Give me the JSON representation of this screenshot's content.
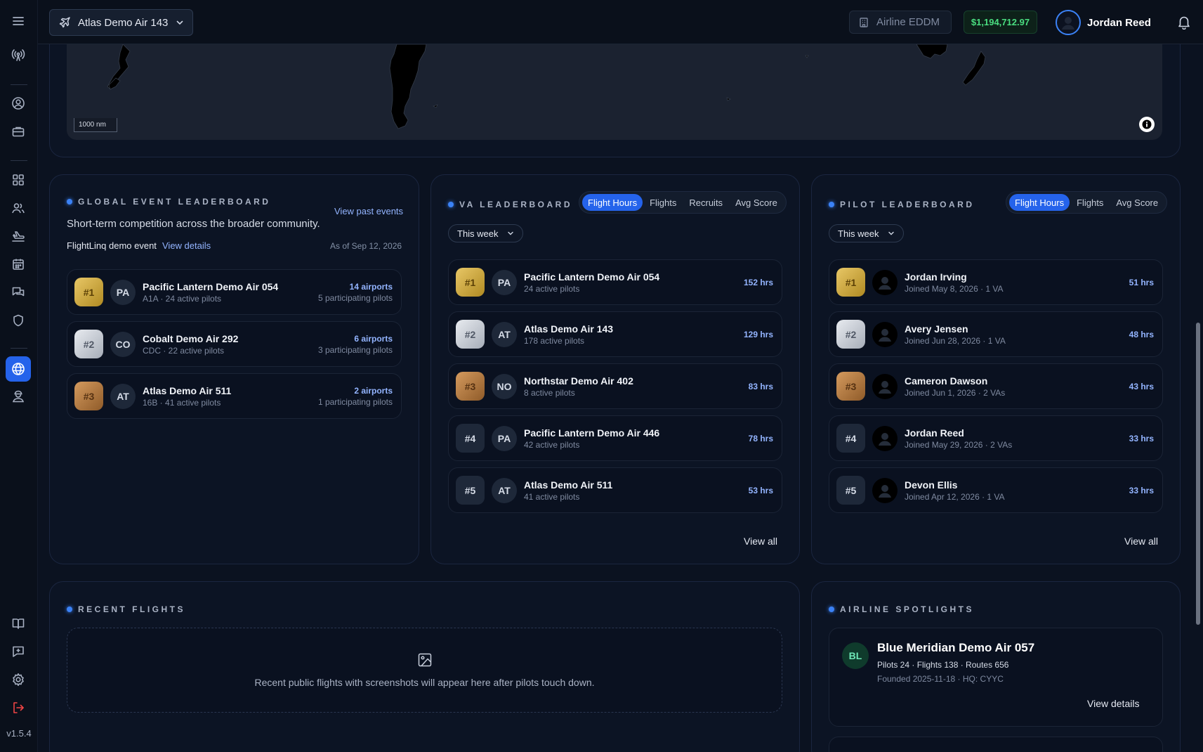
{
  "app": {
    "version": "v1.5.4"
  },
  "topbar": {
    "va_name": "Atlas Demo Air 143",
    "airline_label": "Airline EDDM",
    "balance": "$1,194,712.97",
    "user_name": "Jordan Reed"
  },
  "map": {
    "scale_label": "1000 nm"
  },
  "global_event": {
    "title": "GLOBAL EVENT LEADERBOARD",
    "view_past": "View past events",
    "description": "Short-term competition across the broader community.",
    "event_name": "FlightLinq demo event",
    "view_details": "View details",
    "as_of": "As of Sep 12, 2026",
    "rows": [
      {
        "rank": "#1",
        "abbr": "PA",
        "name": "Pacific Lantern Demo Air 054",
        "sub": "A1A · 24 active pilots",
        "value": "14 airports",
        "value2": "5 participating pilots"
      },
      {
        "rank": "#2",
        "abbr": "CO",
        "name": "Cobalt Demo Air 292",
        "sub": "CDC · 22 active pilots",
        "value": "6 airports",
        "value2": "3 participating pilots"
      },
      {
        "rank": "#3",
        "abbr": "AT",
        "name": "Atlas Demo Air 511",
        "sub": "16B · 41 active pilots",
        "value": "2 airports",
        "value2": "1 participating pilots"
      }
    ]
  },
  "va_leaderboard": {
    "title": "VA LEADERBOARD",
    "tabs": [
      "Flight Hours",
      "Flights",
      "Recruits",
      "Avg Score"
    ],
    "period": "This week",
    "view_all": "View all",
    "rows": [
      {
        "rank": "#1",
        "abbr": "PA",
        "name": "Pacific Lantern Demo Air 054",
        "sub": "24 active pilots",
        "value": "152 hrs"
      },
      {
        "rank": "#2",
        "abbr": "AT",
        "name": "Atlas Demo Air 143",
        "sub": "178 active pilots",
        "value": "129 hrs"
      },
      {
        "rank": "#3",
        "abbr": "NO",
        "name": "Northstar Demo Air 402",
        "sub": "8 active pilots",
        "value": "83 hrs"
      },
      {
        "rank": "#4",
        "abbr": "PA",
        "name": "Pacific Lantern Demo Air 446",
        "sub": "42 active pilots",
        "value": "78 hrs"
      },
      {
        "rank": "#5",
        "abbr": "AT",
        "name": "Atlas Demo Air 511",
        "sub": "41 active pilots",
        "value": "53 hrs"
      }
    ]
  },
  "pilot_leaderboard": {
    "title": "PILOT LEADERBOARD",
    "tabs": [
      "Flight Hours",
      "Flights",
      "Avg Score"
    ],
    "period": "This week",
    "view_all": "View all",
    "rows": [
      {
        "rank": "#1",
        "name": "Jordan Irving",
        "sub": "Joined May 8, 2026 · 1 VA",
        "value": "51 hrs"
      },
      {
        "rank": "#2",
        "name": "Avery Jensen",
        "sub": "Joined Jun 28, 2026 · 1 VA",
        "value": "48 hrs"
      },
      {
        "rank": "#3",
        "name": "Cameron Dawson",
        "sub": "Joined Jun 1, 2026 · 2 VAs",
        "value": "43 hrs"
      },
      {
        "rank": "#4",
        "name": "Jordan Reed",
        "sub": "Joined May 29, 2026 · 2 VAs",
        "value": "33 hrs"
      },
      {
        "rank": "#5",
        "name": "Devon Ellis",
        "sub": "Joined Apr 12, 2026 · 1 VA",
        "value": "33 hrs"
      }
    ]
  },
  "recent_flights": {
    "title": "RECENT FLIGHTS",
    "empty_text": "Recent public flights with screenshots will appear here after pilots touch down."
  },
  "spotlights": {
    "title": "AIRLINE SPOTLIGHTS",
    "items": [
      {
        "abbr": "BL",
        "name": "Blue Meridian Demo Air 057",
        "stats": "Pilots 24 · Flights 138 · Routes 656",
        "founded": "Founded 2025-11-18 · HQ: CYYC",
        "view_details": "View details"
      }
    ]
  },
  "colors": {
    "accent": "#2563eb",
    "gold": "#d4af37",
    "silver": "#c9ced6",
    "bronze": "#b87333",
    "success": "#4ade80",
    "danger": "#ef4444"
  }
}
